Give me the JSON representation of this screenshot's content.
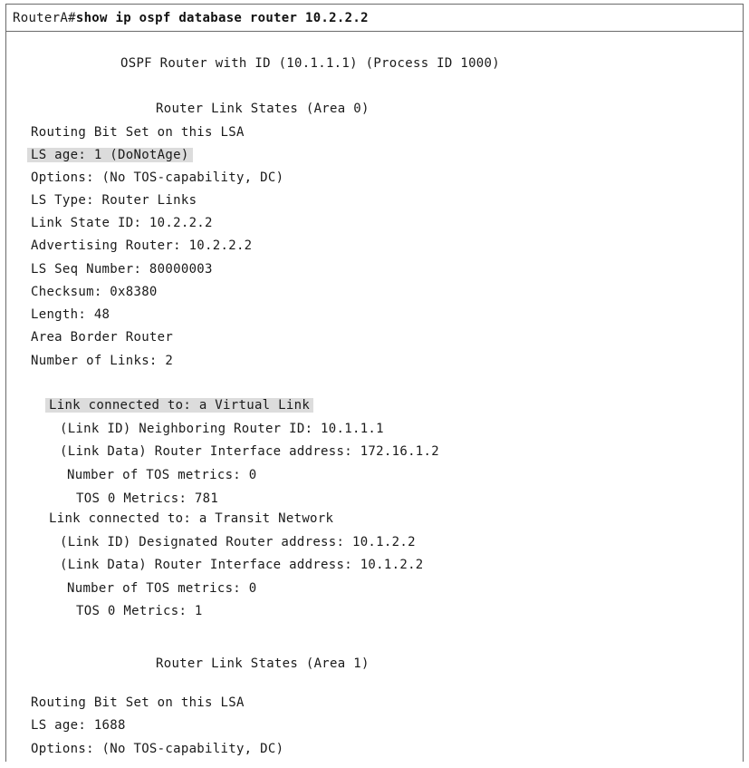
{
  "terminal": {
    "prompt": "RouterA#",
    "command": "show ip ospf database router 10.2.2.2",
    "header": "OSPF Router with ID (10.1.1.1) (Process ID 1000)",
    "area0": {
      "title": "Router Link States (Area 0)",
      "routing_bit": "Routing Bit Set on this LSA",
      "ls_age": "LS age: 1 (DoNotAge)",
      "options": "Options: (No TOS-capability, DC)",
      "ls_type": "LS Type: Router Links",
      "link_state_id": "Link State ID: 10.2.2.2",
      "adv_router": "Advertising Router: 10.2.2.2",
      "seq": "LS Seq Number: 80000003",
      "checksum": "Checksum: 0x8380",
      "length": "Length: 48",
      "abr": "Area Border Router",
      "num_links": "Number of Links: 2",
      "link1": {
        "connected": "Link connected to: a Virtual Link",
        "link_id": "(Link ID) Neighboring Router ID: 10.1.1.1",
        "link_data": "(Link Data) Router Interface address: 172.16.1.2",
        "tos_count": "Number of TOS metrics: 0",
        "tos_metric": "TOS 0 Metrics: 781"
      },
      "link2": {
        "connected": "Link connected to: a Transit Network",
        "link_id": "(Link ID) Designated Router address: 10.1.2.2",
        "link_data": "(Link Data) Router Interface address: 10.1.2.2",
        "tos_count": "Number of TOS metrics: 0",
        "tos_metric": "TOS 0 Metrics: 1"
      }
    },
    "area1": {
      "title": "Router Link States (Area 1)",
      "routing_bit": "Routing Bit Set on this LSA",
      "ls_age": "LS age: 1688",
      "options": "Options: (No TOS-capability, DC)"
    }
  }
}
